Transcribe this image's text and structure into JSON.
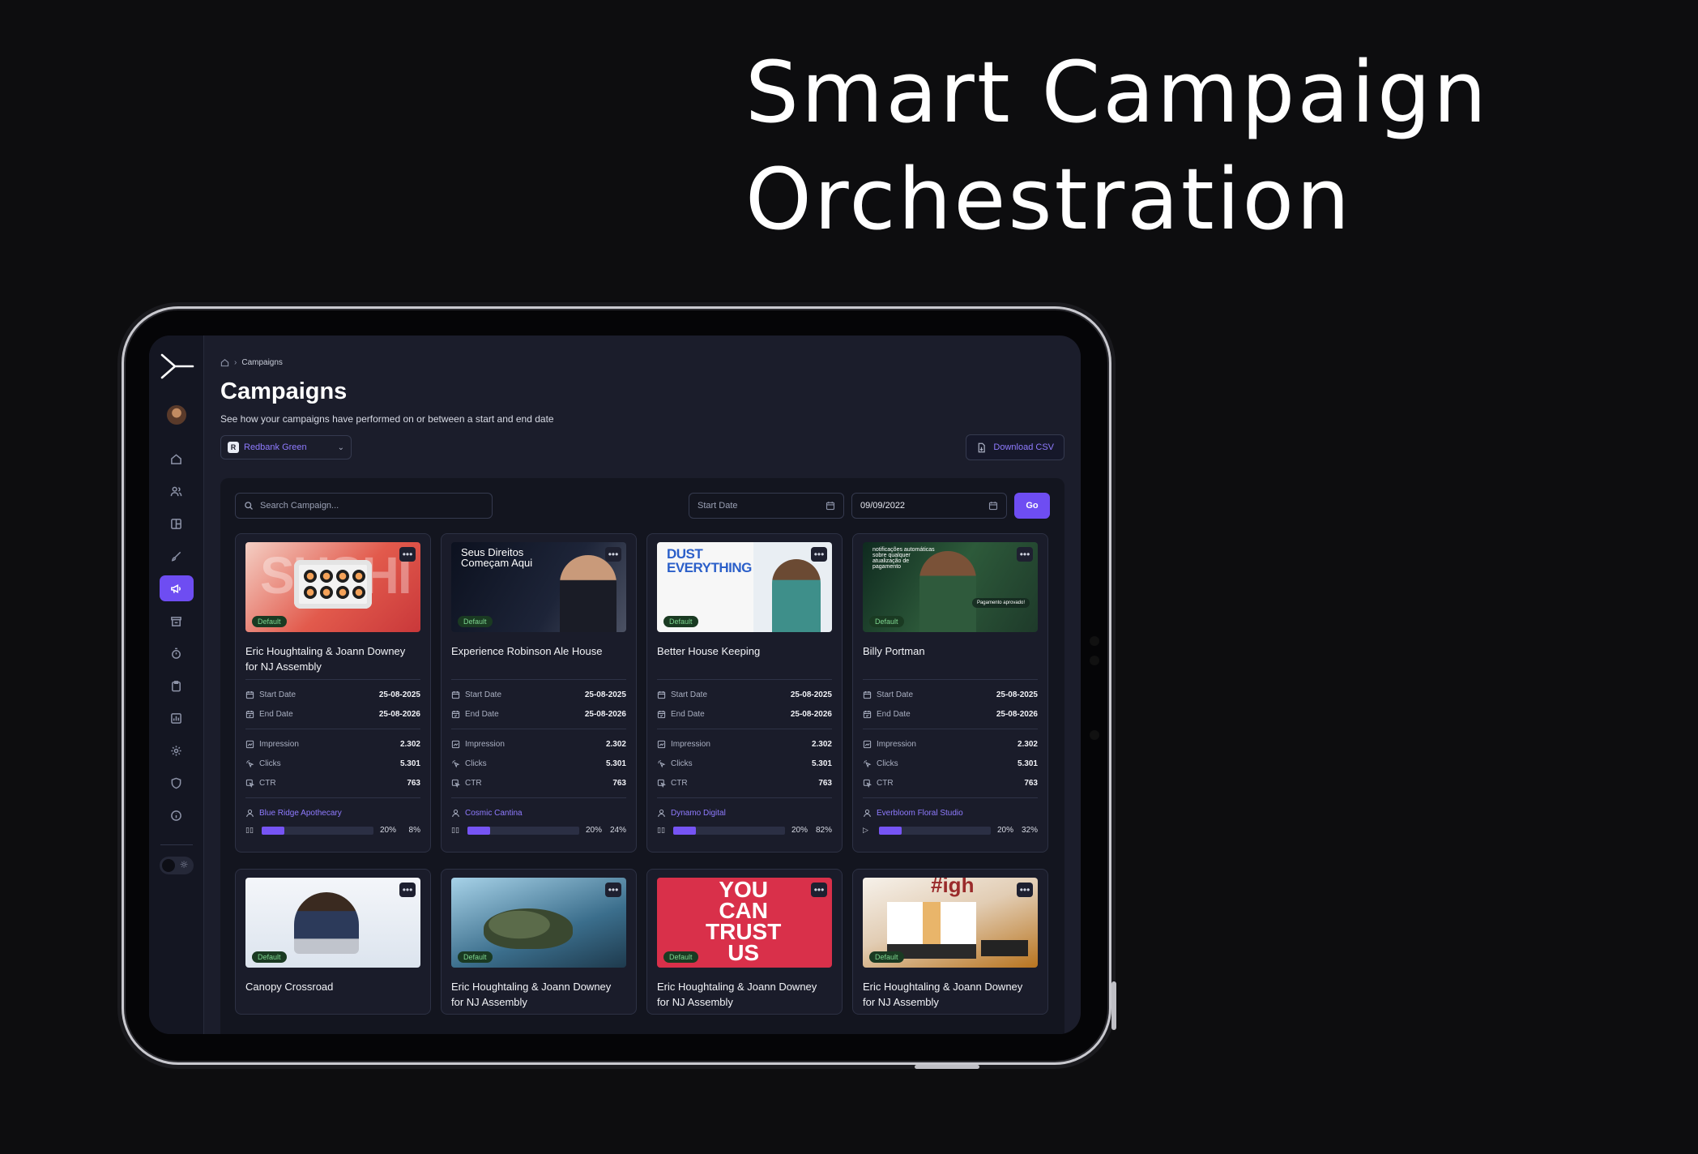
{
  "hero": {
    "line1": "Smart Campaign",
    "line2": "Orchestration"
  },
  "breadcrumb": {
    "current": "Campaigns"
  },
  "page": {
    "title": "Campaigns",
    "subtitle": "See how your campaigns have performed on or between a start and end date"
  },
  "account": {
    "badge": "R",
    "name": "Redbank Green"
  },
  "toolbar": {
    "download_label": "Download CSV"
  },
  "filters": {
    "search_placeholder": "Search Campaign...",
    "start_placeholder": "Start Date",
    "end_value": "09/09/2022",
    "go_label": "Go"
  },
  "labels": {
    "default": "Default",
    "start": "Start Date",
    "end": "End Date",
    "impression": "Impression",
    "clicks": "Clicks",
    "ctr": "CTR",
    "menu": "•••"
  },
  "thumb_text": {
    "sushi": "SUSHI",
    "seus": "Seus Direitos\nComeçam Aqui",
    "dust": "DUST\nEVERYTHING",
    "notif": "notificações automáticas sobre qualquer atualização de pagamento",
    "pill": "Pagamento aprovado!",
    "trust": "YOU\nCAN\nTRUST\nUS",
    "igh": "#igh"
  },
  "campaigns": [
    {
      "name": "Eric Houghtaling & Joann Downey for NJ Assembly",
      "start": "25-08-2025",
      "end": "25-08-2026",
      "impression": "2.302",
      "clicks": "5.301",
      "ctr": "763",
      "client": "Blue Ridge Apothecary",
      "progress_pct": 20,
      "progress_label": "20%",
      "rate": "8%",
      "control": "paused"
    },
    {
      "name": "Experience Robinson Ale House",
      "start": "25-08-2025",
      "end": "25-08-2026",
      "impression": "2.302",
      "clicks": "5.301",
      "ctr": "763",
      "client": "Cosmic Cantina",
      "progress_pct": 20,
      "progress_label": "20%",
      "rate": "24%",
      "control": "paused"
    },
    {
      "name": "Better House Keeping",
      "start": "25-08-2025",
      "end": "25-08-2026",
      "impression": "2.302",
      "clicks": "5.301",
      "ctr": "763",
      "client": "Dynamo Digital",
      "progress_pct": 20,
      "progress_label": "20%",
      "rate": "82%",
      "control": "paused"
    },
    {
      "name": "Billy Portman",
      "start": "25-08-2025",
      "end": "25-08-2026",
      "impression": "2.302",
      "clicks": "5.301",
      "ctr": "763",
      "client": "Everbloom Floral Studio",
      "progress_pct": 20,
      "progress_label": "20%",
      "rate": "32%",
      "control": "play"
    },
    {
      "name": "Canopy Crossroad"
    },
    {
      "name": "Eric Houghtaling & Joann Downey for NJ Assembly"
    },
    {
      "name": "Eric Houghtaling & Joann Downey for NJ Assembly"
    },
    {
      "name": "Eric Houghtaling & Joann Downey for NJ Assembly"
    }
  ],
  "colors": {
    "accent": "#6e4df2",
    "link": "#8f7bff",
    "default_badge": "#7ed690"
  },
  "icons": [
    "logo-icon",
    "home-icon",
    "users-icon",
    "layout-icon",
    "brush-icon",
    "megaphone-icon",
    "store-icon",
    "timer-icon",
    "clipboard-icon",
    "report-icon",
    "settings-icon",
    "shield-icon",
    "info-icon",
    "sun-icon"
  ]
}
